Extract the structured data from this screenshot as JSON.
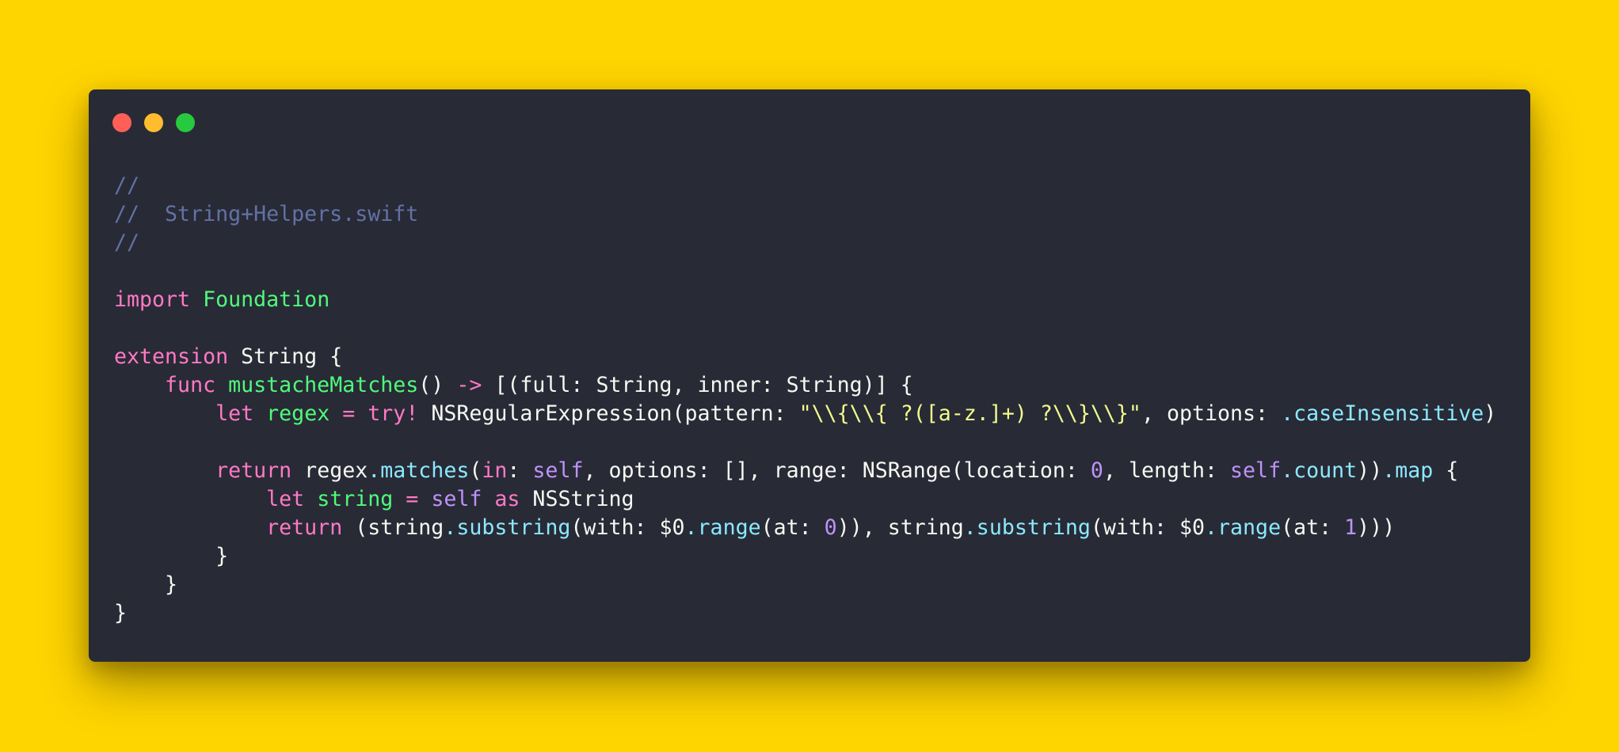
{
  "window": {
    "controls": [
      {
        "name": "close-button",
        "color": "#FF5F56"
      },
      {
        "name": "minimize-button",
        "color": "#FFBD2E"
      },
      {
        "name": "maximize-button",
        "color": "#27C93F"
      }
    ]
  },
  "colors": {
    "background": "#FFD500",
    "editor": "#282A36",
    "comment": "#6272A4",
    "keyword": "#FF79C6",
    "type_green": "#50FA7B",
    "function": "#8BE9FD",
    "string": "#F1FA8C",
    "number": "#BD93F9",
    "default": "#F8F8F2"
  },
  "code": {
    "lines": [
      [
        {
          "t": "//",
          "c": "comment"
        }
      ],
      [
        {
          "t": "//  String+Helpers.swift",
          "c": "comment"
        }
      ],
      [
        {
          "t": "//",
          "c": "comment"
        }
      ],
      [],
      [
        {
          "t": "import",
          "c": "keyword"
        },
        {
          "t": " ",
          "c": "default"
        },
        {
          "t": "Foundation",
          "c": "type_green"
        }
      ],
      [],
      [
        {
          "t": "extension",
          "c": "keyword"
        },
        {
          "t": " String {",
          "c": "default"
        }
      ],
      [
        {
          "t": "    ",
          "c": "default"
        },
        {
          "t": "func",
          "c": "keyword"
        },
        {
          "t": " ",
          "c": "default"
        },
        {
          "t": "mustacheMatches",
          "c": "type_green"
        },
        {
          "t": "() ",
          "c": "default"
        },
        {
          "t": "->",
          "c": "keyword"
        },
        {
          "t": " [(full: String, inner: String)] {",
          "c": "default"
        }
      ],
      [
        {
          "t": "        ",
          "c": "default"
        },
        {
          "t": "let",
          "c": "keyword"
        },
        {
          "t": " ",
          "c": "default"
        },
        {
          "t": "regex",
          "c": "type_green"
        },
        {
          "t": " ",
          "c": "default"
        },
        {
          "t": "=",
          "c": "keyword"
        },
        {
          "t": " ",
          "c": "default"
        },
        {
          "t": "try!",
          "c": "keyword"
        },
        {
          "t": " NSRegularExpression(pattern: ",
          "c": "default"
        },
        {
          "t": "\"\\\\{\\\\{ ?([a-z.]+) ?\\\\}\\\\}\"",
          "c": "string"
        },
        {
          "t": ", options: ",
          "c": "default"
        },
        {
          "t": ".caseInsensitive",
          "c": "function"
        },
        {
          "t": ")",
          "c": "default"
        }
      ],
      [],
      [
        {
          "t": "        ",
          "c": "default"
        },
        {
          "t": "return",
          "c": "keyword"
        },
        {
          "t": " regex",
          "c": "default"
        },
        {
          "t": ".matches",
          "c": "function"
        },
        {
          "t": "(",
          "c": "default"
        },
        {
          "t": "in",
          "c": "keyword"
        },
        {
          "t": ": ",
          "c": "default"
        },
        {
          "t": "self",
          "c": "number"
        },
        {
          "t": ", options: [], range: NSRange(location: ",
          "c": "default"
        },
        {
          "t": "0",
          "c": "number"
        },
        {
          "t": ", length: ",
          "c": "default"
        },
        {
          "t": "self",
          "c": "number"
        },
        {
          "t": ".count",
          "c": "function"
        },
        {
          "t": "))",
          "c": "default"
        },
        {
          "t": ".map",
          "c": "function"
        },
        {
          "t": " {",
          "c": "default"
        }
      ],
      [
        {
          "t": "            ",
          "c": "default"
        },
        {
          "t": "let",
          "c": "keyword"
        },
        {
          "t": " ",
          "c": "default"
        },
        {
          "t": "string",
          "c": "type_green"
        },
        {
          "t": " ",
          "c": "default"
        },
        {
          "t": "=",
          "c": "keyword"
        },
        {
          "t": " ",
          "c": "default"
        },
        {
          "t": "self",
          "c": "number"
        },
        {
          "t": " ",
          "c": "default"
        },
        {
          "t": "as",
          "c": "keyword"
        },
        {
          "t": " NSString",
          "c": "default"
        }
      ],
      [
        {
          "t": "            ",
          "c": "default"
        },
        {
          "t": "return",
          "c": "keyword"
        },
        {
          "t": " (string",
          "c": "default"
        },
        {
          "t": ".substring",
          "c": "function"
        },
        {
          "t": "(with: $0",
          "c": "default"
        },
        {
          "t": ".range",
          "c": "function"
        },
        {
          "t": "(at: ",
          "c": "default"
        },
        {
          "t": "0",
          "c": "number"
        },
        {
          "t": ")), string",
          "c": "default"
        },
        {
          "t": ".substring",
          "c": "function"
        },
        {
          "t": "(with: $0",
          "c": "default"
        },
        {
          "t": ".range",
          "c": "function"
        },
        {
          "t": "(at: ",
          "c": "default"
        },
        {
          "t": "1",
          "c": "number"
        },
        {
          "t": ")))",
          "c": "default"
        }
      ],
      [
        {
          "t": "        }",
          "c": "default"
        }
      ],
      [
        {
          "t": "    }",
          "c": "default"
        }
      ],
      [
        {
          "t": "}",
          "c": "default"
        }
      ]
    ]
  }
}
